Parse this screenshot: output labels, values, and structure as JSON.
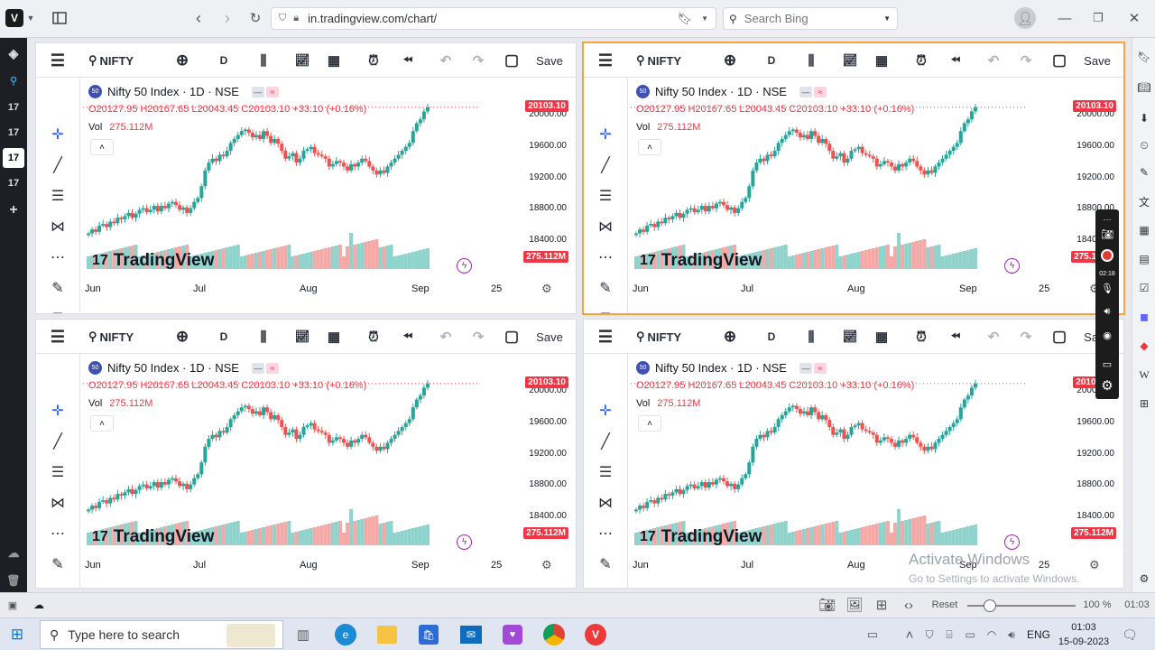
{
  "browser": {
    "url": "in.tradingview.com/chart/",
    "search_placeholder": "Search Bing"
  },
  "left_strip": {
    "items": [
      "17",
      "17",
      "17",
      "17"
    ]
  },
  "panes": [
    {
      "symbol": "NIFTY",
      "interval": "D",
      "save": "Save",
      "title": "Nifty 50 Index · 1D · NSE",
      "ohlc": "O20127.95  H20167.65  L20043.45  C20103.10  +33.10 (+0.16%)",
      "vol_label": "Vol",
      "vol_value": "275.112M",
      "price_tag": "20103.10",
      "vol_tag": "275.112M",
      "prices": [
        "20000.00",
        "19600.00",
        "19200.00",
        "18800.00",
        "18400.00"
      ],
      "months": [
        "Jun",
        "Jul",
        "Aug",
        "Sep",
        "25"
      ],
      "logo": "TradingView"
    },
    {
      "symbol": "NIFTY",
      "interval": "D",
      "save": "Save",
      "title": "Nifty 50 Index · 1D · NSE",
      "ohlc": "O20127.95  H20167.65  L20043.45  C20103.10  +33.10 (+0.16%)",
      "vol_label": "Vol",
      "vol_value": "275.112M",
      "price_tag": "20103.10",
      "vol_tag": "275.112M",
      "prices": [
        "20000.00",
        "19600.00",
        "19200.00",
        "18800.00",
        "18400.00"
      ],
      "months": [
        "Jun",
        "Jul",
        "Aug",
        "Sep",
        "25"
      ],
      "logo": "TradingView"
    },
    {
      "symbol": "NIFTY",
      "interval": "D",
      "save": "Save",
      "title": "Nifty 50 Index · 1D · NSE",
      "ohlc": "O20127.95  H20167.65  L20043.45  C20103.10  +33.10 (+0.16%)",
      "vol_label": "Vol",
      "vol_value": "275.112M",
      "price_tag": "20103.10",
      "vol_tag": "275.112M",
      "prices": [
        "20000.00",
        "19600.00",
        "19200.00",
        "18800.00",
        "18400.00"
      ],
      "months": [
        "Jun",
        "Jul",
        "Aug",
        "Sep",
        "25"
      ],
      "logo": "TradingView"
    },
    {
      "symbol": "NIFTY",
      "interval": "D",
      "save": "Save",
      "title": "Nifty 50 Index · 1D · NSE",
      "ohlc": "O20127.95  H20167.65  L20043.45  C20103.10  +33.10 (+0.16%)",
      "vol_label": "Vol",
      "vol_value": "275.112M",
      "price_tag": "20103.10",
      "vol_tag": "275.112M",
      "prices": [
        "20000.00",
        "19600.00",
        "19200.00",
        "18800.00",
        "18400.00"
      ],
      "months": [
        "Jun",
        "Jul",
        "Aug",
        "Sep",
        "25"
      ],
      "logo": "TradingView"
    }
  ],
  "recorder": {
    "time": "02:18"
  },
  "status": {
    "reset": "Reset",
    "zoom": "100 %",
    "clock": "01:03"
  },
  "activation": {
    "title": "Activate Windows",
    "sub": "Go to Settings to activate Windows."
  },
  "taskbar": {
    "search_placeholder": "Type here to search",
    "lang": "ENG",
    "time": "01:03",
    "date": "15-09-2023"
  },
  "colors": {
    "up": "#26a69a",
    "down": "#ef5350",
    "accent": "#f2a53d",
    "price_tag": "#f23645"
  },
  "chart_data": {
    "type": "candlestick",
    "title": "Nifty 50 Index · 1D · NSE",
    "ylim": [
      18300,
      20250
    ],
    "x_ticks": [
      "Jun",
      "Jul",
      "Aug",
      "Sep",
      "25"
    ],
    "y_ticks": [
      20000,
      19600,
      19200,
      18800,
      18400
    ],
    "close": [
      18500,
      18550,
      18520,
      18600,
      18620,
      18580,
      18650,
      18630,
      18700,
      18680,
      18720,
      18760,
      18700,
      18750,
      18800,
      18820,
      18770,
      18800,
      18850,
      18780,
      18850,
      18820,
      18880,
      18900,
      18860,
      18800,
      18830,
      18760,
      18820,
      18900,
      18950,
      19100,
      19300,
      19400,
      19450,
      19420,
      19500,
      19480,
      19550,
      19650,
      19700,
      19750,
      19800,
      19820,
      19780,
      19720,
      19750,
      19700,
      19800,
      19740,
      19650,
      19700,
      19640,
      19550,
      19450,
      19480,
      19520,
      19400,
      19450,
      19550,
      19570,
      19600,
      19520,
      19500,
      19480,
      19450,
      19350,
      19380,
      19420,
      19400,
      19350,
      19300,
      19380,
      19350,
      19400,
      19450,
      19420,
      19350,
      19300,
      19250,
      19300,
      19270,
      19350,
      19400,
      19450,
      19500,
      19550,
      19600,
      19650,
      19800,
      19900,
      19950,
      20050,
      20103
    ],
    "volume_last": "275.112M"
  }
}
